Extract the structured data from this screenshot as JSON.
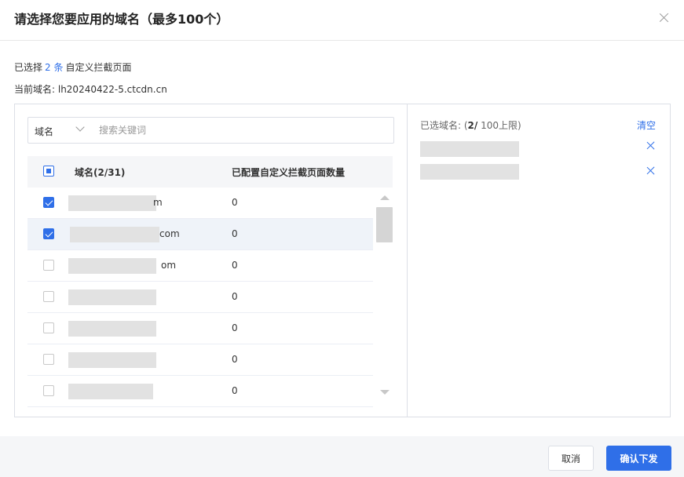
{
  "dialog": {
    "title": "请选择您要应用的域名（最多100个）",
    "close_icon": "close-icon"
  },
  "summary": {
    "prefix": "已选择",
    "count": "2 条",
    "suffix": "自定义拦截页面",
    "current_domain": "当前域名: lh20240422-5.ctcdn.cn"
  },
  "search": {
    "type_label": "域名",
    "placeholder": "搜索关键词"
  },
  "table": {
    "header_name": "域名(2/31)",
    "header_count": "已配置自定义拦截页面数量",
    "rows": [
      {
        "name": "m",
        "count": "0",
        "checked": true
      },
      {
        "name": "com",
        "count": "0",
        "checked": true
      },
      {
        "name": "om",
        "count": "0",
        "checked": false
      },
      {
        "name": "",
        "count": "0",
        "checked": false
      },
      {
        "name": "",
        "count": "0",
        "checked": false
      },
      {
        "name": "",
        "count": "0",
        "checked": false
      },
      {
        "name": "",
        "count": "0",
        "checked": false
      }
    ]
  },
  "selected_panel": {
    "label_prefix": "已选域名: (",
    "label_count": "2/",
    "label_suffix": " 100上限)",
    "clear_label": "清空"
  },
  "footer": {
    "cancel_label": "取消",
    "confirm_label": "确认下发"
  },
  "colors": {
    "accent": "#2f6fe8",
    "border": "#dcdfe6",
    "header_bg": "#f5f6f8"
  }
}
